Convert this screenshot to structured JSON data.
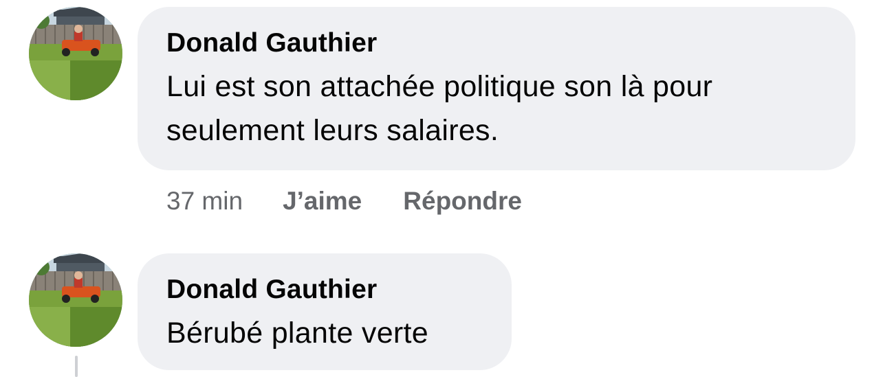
{
  "comments": [
    {
      "author": "Donald Gauthier",
      "text_lines": [
        "Lui est son attachée politique son là pour",
        "seulement leurs salaires."
      ],
      "avatar_icon": "profile-photo-lawn-mower",
      "meta": {
        "time": "37 min",
        "like_label": "J’aime",
        "reply_label": "Répondre"
      }
    },
    {
      "author": "Donald Gauthier",
      "text_lines": [
        "Bérubé plante verte"
      ],
      "avatar_icon": "profile-photo-lawn-mower"
    }
  ],
  "colors": {
    "bubble": "#eff0f3",
    "text": "#050505",
    "meta": "#65676b",
    "thread_line": "#ced0d4"
  }
}
